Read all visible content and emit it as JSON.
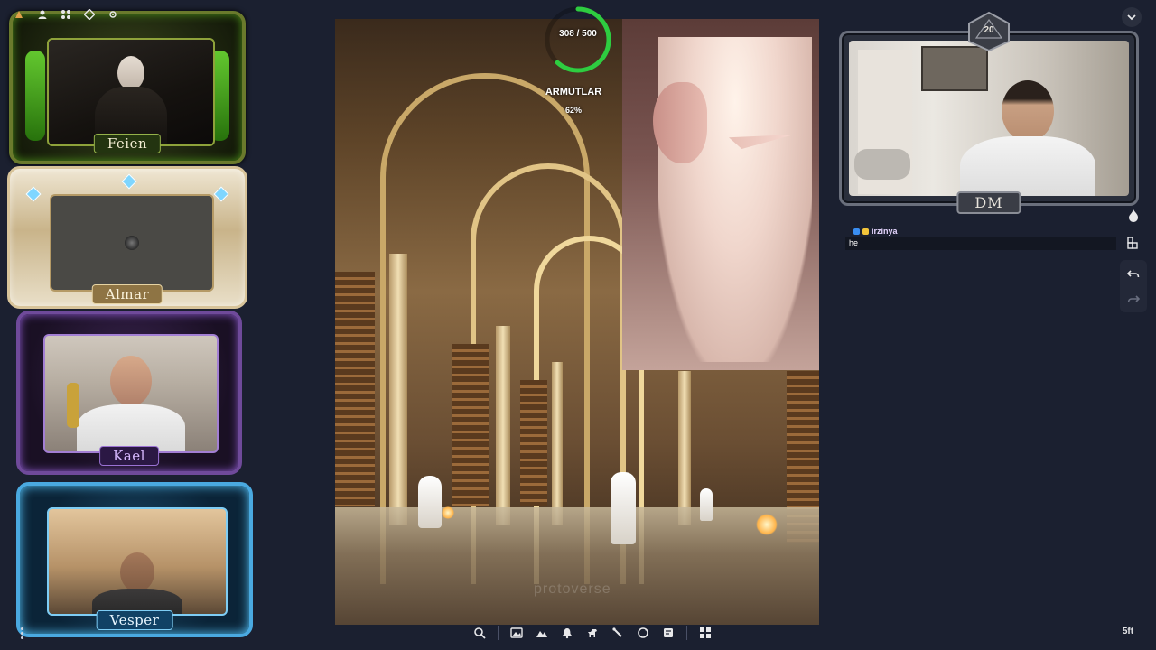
{
  "players": [
    {
      "name": "Feien"
    },
    {
      "name": "Almar"
    },
    {
      "name": "Kael"
    },
    {
      "name": "Vesper"
    }
  ],
  "dm": {
    "label": "DM",
    "die_value": "20"
  },
  "progress": {
    "text": "308 / 500",
    "title": "ARMUTLAR",
    "percent": "62%",
    "fraction": 0.616
  },
  "scene": {
    "watermark": "protoverse"
  },
  "chat": {
    "username": "irzinya",
    "message": "he"
  },
  "scale": {
    "label": "5ft"
  },
  "toolbar": {
    "icons": [
      "search-icon",
      "image-icon",
      "terrain-icon",
      "bell-icon",
      "horse-icon",
      "brush-icon",
      "sync-icon",
      "notes-icon",
      "apps-icon"
    ]
  },
  "right_tools": {
    "icons": [
      "fire-icon",
      "layers-icon",
      "undo-icon",
      "redo-icon"
    ]
  },
  "colors": {
    "progress_ring": "#2ecc40",
    "background": "#1b2030"
  }
}
